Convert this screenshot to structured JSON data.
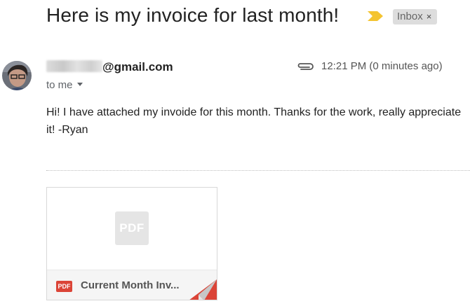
{
  "email": {
    "subject": "Here is my invoice for last month!",
    "label": {
      "name": "Inbox",
      "remove_glyph": "×"
    },
    "importance_icon": "importance-marker-icon",
    "sender": {
      "visible_email": "@gmail.com"
    },
    "recipient_text": "to me",
    "has_attachment_icon": "paperclip-icon",
    "timestamp": "12:21 PM (0 minutes ago)",
    "body": "Hi! I have attached my invoide for this month. Thanks for the work, really appreciate it! -Ryan"
  },
  "attachment": {
    "thumb_text": "PDF",
    "type_badge": "PDF",
    "name": "Current Month Inv..."
  },
  "colors": {
    "importance": "#f4c430",
    "pdf_red": "#db4437",
    "label_bg": "#dddddd"
  }
}
